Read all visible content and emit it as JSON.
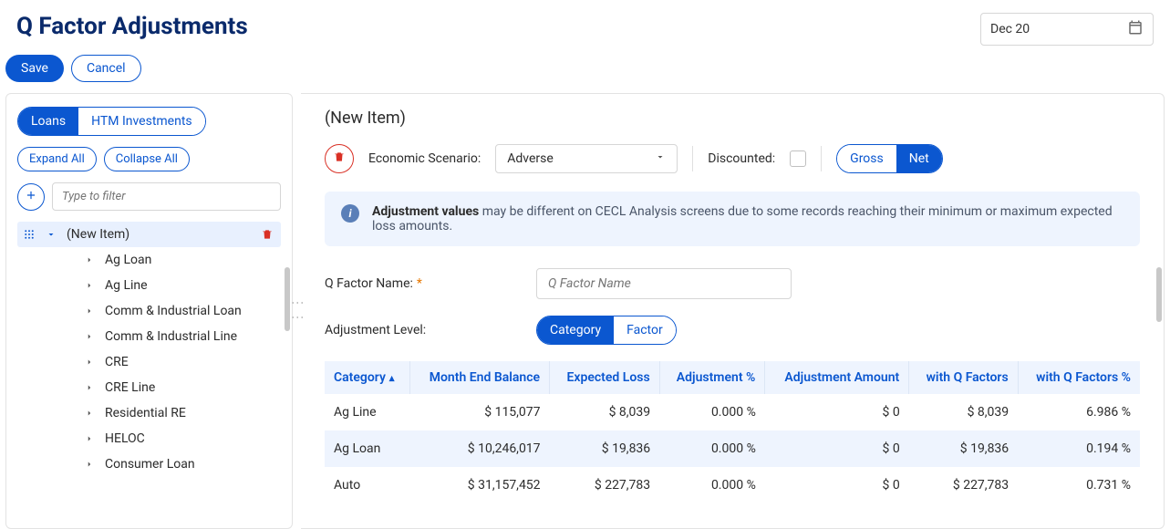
{
  "header": {
    "title": "Q Factor Adjustments",
    "date": "Dec 20",
    "save_label": "Save",
    "cancel_label": "Cancel"
  },
  "left": {
    "tabs": {
      "loans": "Loans",
      "htm": "HTM Investments"
    },
    "expand_label": "Expand All",
    "collapse_label": "Collapse All",
    "filter_placeholder": "Type to filter",
    "tree": {
      "root": "(New Item)",
      "children": [
        "Ag Loan",
        "Ag Line",
        "Comm & Industrial Loan",
        "Comm & Industrial Line",
        "CRE",
        "CRE Line",
        "Residential RE",
        "HELOC",
        "Consumer Loan"
      ]
    }
  },
  "right": {
    "title": "(New Item)",
    "scenario_label": "Economic Scenario:",
    "scenario_value": "Adverse",
    "discounted_label": "Discounted:",
    "gross_label": "Gross",
    "net_label": "Net",
    "info_bold": "Adjustment values",
    "info_text": " may be different on CECL Analysis screens due to some records reaching their minimum or maximum expected loss amounts.",
    "name_label": "Q Factor Name:",
    "name_placeholder": "Q Factor Name",
    "level_label": "Adjustment Level:",
    "level_category": "Category",
    "level_factor": "Factor",
    "columns": {
      "category": "Category",
      "balance": "Month End Balance",
      "expected": "Expected Loss",
      "adj_pct": "Adjustment %",
      "adj_amt": "Adjustment Amount",
      "with_q": "with Q Factors",
      "with_q_pct": "with Q Factors %"
    },
    "rows": [
      {
        "category": "Ag Line",
        "balance": "$ 115,077",
        "expected": "$ 8,039",
        "adj_pct": "0.000 %",
        "adj_amt": "$ 0",
        "with_q": "$ 8,039",
        "with_q_pct": "6.986 %"
      },
      {
        "category": "Ag Loan",
        "balance": "$ 10,246,017",
        "expected": "$ 19,836",
        "adj_pct": "0.000 %",
        "adj_amt": "$ 0",
        "with_q": "$ 19,836",
        "with_q_pct": "0.194 %"
      },
      {
        "category": "Auto",
        "balance": "$ 31,157,452",
        "expected": "$ 227,783",
        "adj_pct": "0.000 %",
        "adj_amt": "$ 0",
        "with_q": "$ 227,783",
        "with_q_pct": "0.731 %"
      }
    ]
  }
}
